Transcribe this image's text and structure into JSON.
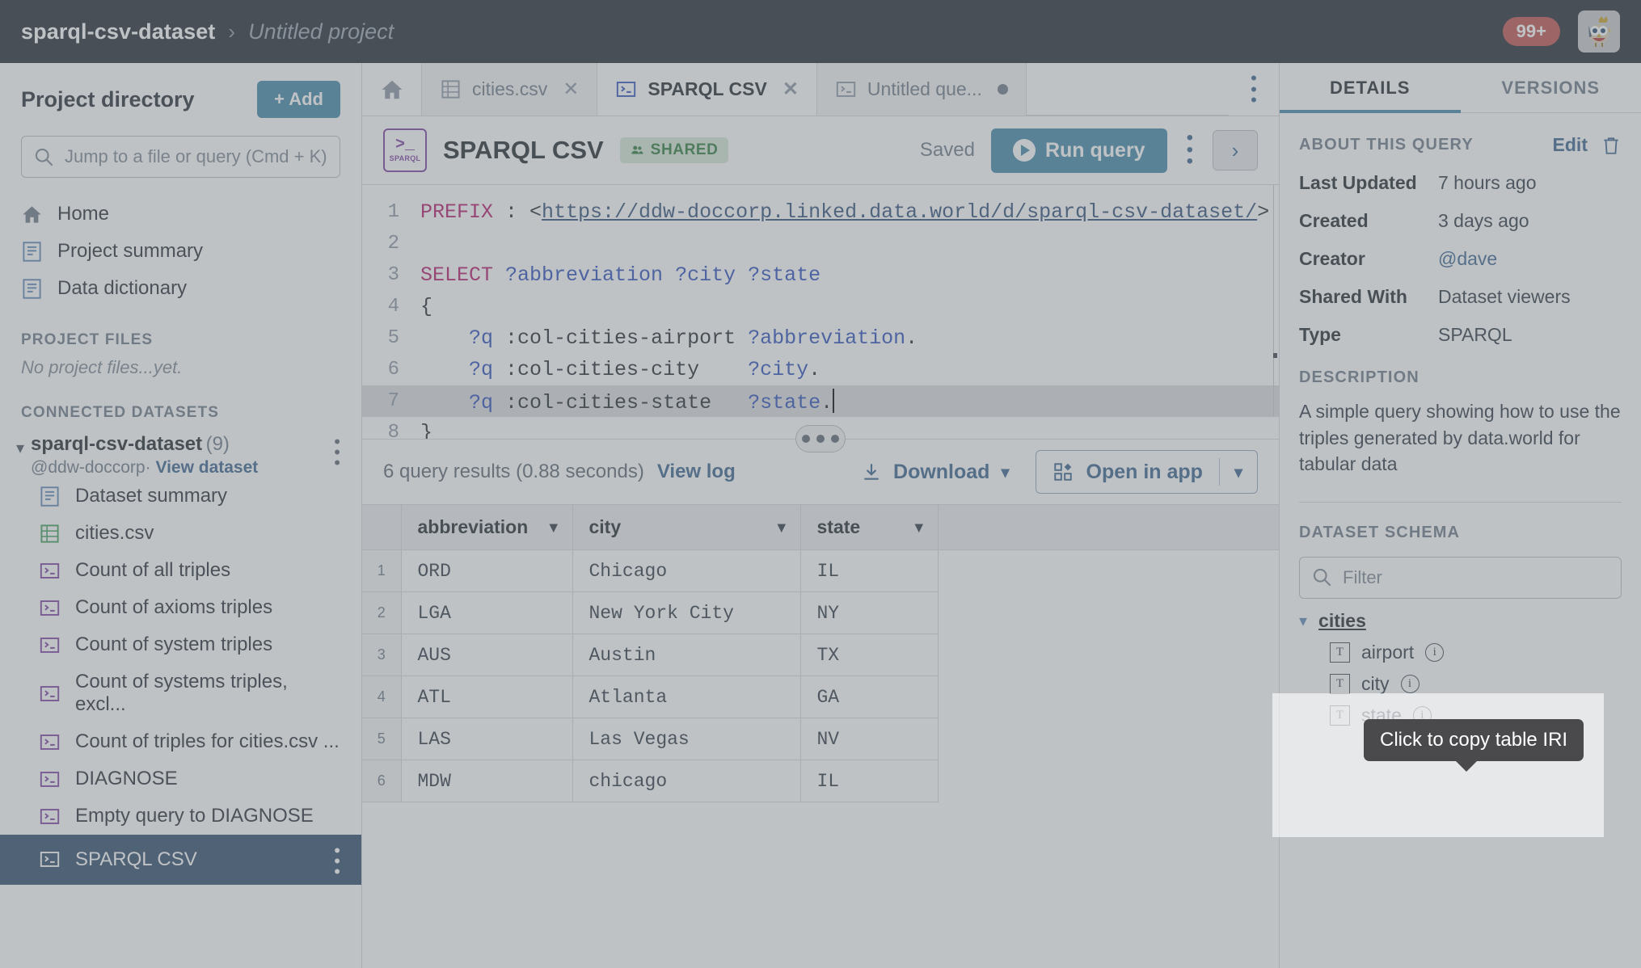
{
  "topbar": {
    "breadcrumb_dataset": "sparql-csv-dataset",
    "breadcrumb_sep": "›",
    "breadcrumb_project": "Untitled project",
    "notification_badge": "99+",
    "avatar_icon": "owl-avatar"
  },
  "sidebar": {
    "title": "Project directory",
    "add_button": "+ Add",
    "search_placeholder": "Jump to a file or query (Cmd + K)",
    "nav": [
      {
        "label": "Home",
        "icon": "home-icon"
      },
      {
        "label": "Project summary",
        "icon": "document-icon"
      },
      {
        "label": "Data dictionary",
        "icon": "document-icon"
      }
    ],
    "project_files_heading": "PROJECT FILES",
    "project_files_empty": "No project files...yet.",
    "connected_heading": "CONNECTED DATASETS",
    "dataset": {
      "name": "sparql-csv-dataset",
      "count": "(9)",
      "owner": "@ddw-doccorp",
      "separator": "·",
      "view_link": "View dataset"
    },
    "files": [
      {
        "label": "Dataset summary",
        "icon": "document-icon",
        "active": false
      },
      {
        "label": "cities.csv",
        "icon": "table-icon",
        "active": false
      },
      {
        "label": "Count of all triples",
        "icon": "sparql-icon",
        "active": false
      },
      {
        "label": "Count of axioms triples",
        "icon": "sparql-icon",
        "active": false
      },
      {
        "label": "Count of system triples",
        "icon": "sparql-icon",
        "active": false
      },
      {
        "label": "Count of systems triples, excl...",
        "icon": "sparql-icon",
        "active": false
      },
      {
        "label": "Count of triples for cities.csv ...",
        "icon": "sparql-icon",
        "active": false
      },
      {
        "label": "DIAGNOSE",
        "icon": "sparql-icon",
        "active": false
      },
      {
        "label": "Empty query to DIAGNOSE",
        "icon": "sparql-icon",
        "active": false
      },
      {
        "label": "SPARQL CSV",
        "icon": "sparql-icon",
        "active": true
      }
    ]
  },
  "tabs": [
    {
      "label": "cities.csv",
      "icon": "table-icon",
      "active": false,
      "closable": true
    },
    {
      "label": "SPARQL CSV",
      "icon": "sparql-icon",
      "active": true,
      "closable": true
    },
    {
      "label": "Untitled que...",
      "icon": "sparql-icon",
      "active": false,
      "closable": false,
      "unsaved": true
    }
  ],
  "query_header": {
    "icon_gt": ">_",
    "icon_name": "SPARQL",
    "title": "SPARQL CSV",
    "shared_pill": "SHARED",
    "saved_label": "Saved",
    "run_button": "Run query",
    "collapse_icon": "›"
  },
  "editor": {
    "lines": [
      {
        "n": "1",
        "html": "<span class='kw'>PREFIX</span> : &lt;<span class='iri'>https://ddw-doccorp.linked.data.world/d/sparql-csv-dataset/</span>&gt;",
        "current": false
      },
      {
        "n": "2",
        "html": "",
        "current": false
      },
      {
        "n": "3",
        "html": "<span class='kw'>SELECT</span> <span class='var'>?abbreviation</span> <span class='var'>?city</span> <span class='var'>?state</span>",
        "current": false
      },
      {
        "n": "4",
        "html": "{",
        "current": false
      },
      {
        "n": "5",
        "html": "    <span class='var'>?q</span> :col-cities-airport <span class='var'>?abbreviation</span>.",
        "current": false
      },
      {
        "n": "6",
        "html": "    <span class='var'>?q</span> :col-cities-city    <span class='var'>?city</span>.",
        "current": false
      },
      {
        "n": "7",
        "html": "    <span class='var'>?q</span> :col-cities-state   <span class='var'>?state</span>.<span class='caret-blk'></span>",
        "current": true
      },
      {
        "n": "8",
        "html": "}",
        "current": false
      }
    ],
    "plain_text": "PREFIX : <https://ddw-doccorp.linked.data.world/d/sparql-csv-dataset/>\n\nSELECT ?abbreviation ?city ?state\n{\n    ?q :col-cities-airport ?abbreviation.\n    ?q :col-cities-city    ?city.\n    ?q :col-cities-state   ?state.\n}"
  },
  "results_bar": {
    "count_text": "6 query results (0.88 seconds)",
    "view_log": "View log",
    "download": "Download",
    "open_in_app": "Open in app"
  },
  "results_table": {
    "columns": [
      "abbreviation",
      "city",
      "state"
    ],
    "rows": [
      {
        "num": "1",
        "abbreviation": "ORD",
        "city": "Chicago",
        "state": "IL"
      },
      {
        "num": "2",
        "abbreviation": "LGA",
        "city": "New York City",
        "state": "NY"
      },
      {
        "num": "3",
        "abbreviation": "AUS",
        "city": "Austin",
        "state": "TX"
      },
      {
        "num": "4",
        "abbreviation": "ATL",
        "city": "Atlanta",
        "state": "GA"
      },
      {
        "num": "5",
        "abbreviation": "LAS",
        "city": "Las Vegas",
        "state": "NV"
      },
      {
        "num": "6",
        "abbreviation": "MDW",
        "city": "chicago",
        "state": "IL"
      }
    ]
  },
  "details_panel": {
    "tabs": [
      {
        "label": "DETAILS",
        "active": true
      },
      {
        "label": "VERSIONS",
        "active": false
      }
    ],
    "about_heading": "ABOUT THIS QUERY",
    "edit_label": "Edit",
    "delete_icon": "trash-icon",
    "fields": [
      {
        "key": "Last Updated",
        "value": "7 hours ago",
        "link": false
      },
      {
        "key": "Created",
        "value": "3 days ago",
        "link": false
      },
      {
        "key": "Creator",
        "value": "@dave",
        "link": true
      },
      {
        "key": "Shared With",
        "value": "Dataset viewers",
        "link": false
      },
      {
        "key": "Type",
        "value": "SPARQL",
        "link": false
      }
    ],
    "description_heading": "DESCRIPTION",
    "description": "A simple query showing how to use the triples generated by data.world for tabular data",
    "schema_heading": "DATASET SCHEMA",
    "filter_placeholder": "Filter",
    "schema_table": "cities",
    "schema_columns": [
      {
        "label": "airport",
        "type_icon": "text-type-icon"
      },
      {
        "label": "city",
        "type_icon": "text-type-icon"
      },
      {
        "label": "state",
        "type_icon": "text-type-icon"
      }
    ]
  },
  "tooltip": {
    "text": "Click to copy table IRI"
  },
  "colors": {
    "topbar_bg": "#1f2730",
    "accent_blue": "#3f87a6",
    "link_blue": "#37628f",
    "sparql_purple": "#7b3fa0",
    "csv_green": "#3f9d5c",
    "active_item_bg": "#2e4a69",
    "badge_red": "#c0504d",
    "shared_green": "#2f7b3d",
    "tooltip_bg": "#4a4a4d"
  }
}
